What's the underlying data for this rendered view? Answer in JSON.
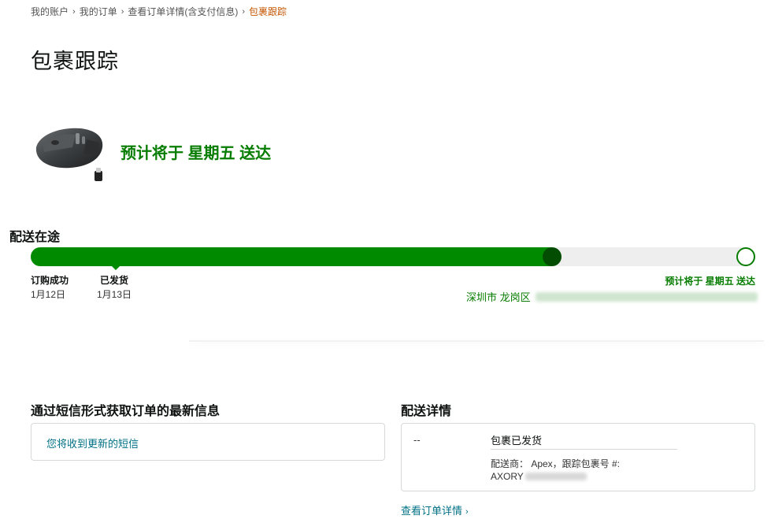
{
  "breadcrumb": {
    "items": [
      "我的账户",
      "我的订单",
      "查看订单详情(含支付信息)"
    ],
    "current": "包裹跟踪",
    "separator": "›"
  },
  "page": {
    "title": "包裹跟踪"
  },
  "shipment": {
    "eta_headline": "预计将于 星期五 送达",
    "status_title": "配送在途",
    "progress_fraction": 0.72,
    "milestones": [
      {
        "label": "订购成功",
        "date": "1月12日"
      },
      {
        "label": "已发货",
        "date": "1月13日"
      }
    ],
    "eta_small": "预计将于 星期五 送达",
    "address_visible": "深圳市 龙岗区"
  },
  "sms": {
    "title": "通过短信形式获取订单的最新信息",
    "link": "您将收到更新的短信"
  },
  "delivery_detail": {
    "title": "配送详情",
    "time": "--",
    "status": "包裹已发货",
    "carrier_line": "配送商： Apex，跟踪包裹号 #:",
    "tracking_prefix": "AXORY"
  },
  "links": {
    "view_order": "查看订单详情",
    "chevron": "›"
  },
  "colors": {
    "green_text": "#067d00",
    "progress_fill": "#008a00",
    "progress_knob": "#034d03",
    "track_bg": "#eeeeee",
    "link": "#007185",
    "breadcrumb_current": "#c45500"
  }
}
